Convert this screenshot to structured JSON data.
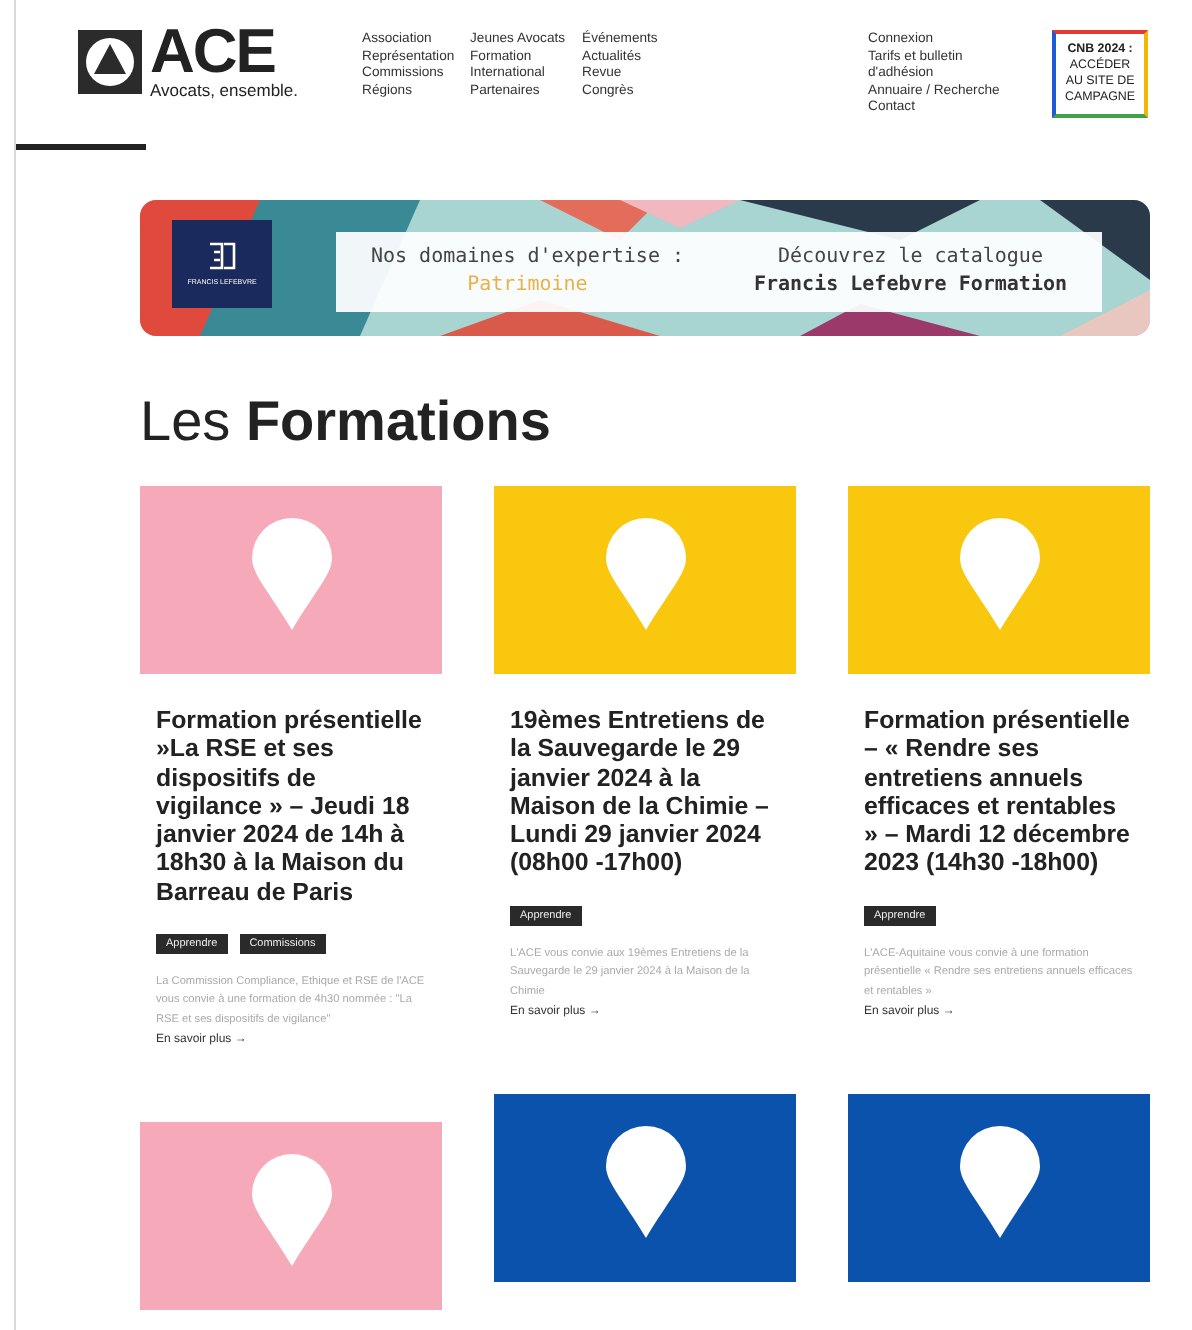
{
  "header": {
    "logo": {
      "name": "ACE",
      "tagline": "Avocats, ensemble."
    },
    "nav_columns": [
      [
        "Association",
        "Représentation",
        "Commissions",
        "Régions"
      ],
      [
        "Jeunes Avocats",
        "Formation",
        "International",
        "Partenaires"
      ],
      [
        "Événements",
        "Actualités",
        "Revue",
        "Congrès"
      ]
    ],
    "account_links": [
      "Connexion",
      "Tarifs et bulletin d'adhésion",
      "Annuaire / Recherche",
      "Contact"
    ],
    "campaign_button": {
      "title": "CNB 2024 :",
      "text": "ACCÉDER AU SITE DE CAMPAGNE"
    }
  },
  "banner": {
    "logo_text": "FRANCIS LEFEBVRE",
    "left_line": "Nos domaines d'expertise :",
    "left_highlight": "Patrimoine",
    "right_line": "Découvrez le catalogue",
    "right_bold": "Francis Lefebvre Formation"
  },
  "section_title": "Les **Formations**",
  "columns": [
    {
      "cards": [
        {
          "color": "#f6a9b8",
          "title": "Formation présentielle »La RSE et ses dispositifs de vigilance » – Jeudi 18 janvier 2024 de 14h à 18h30 à la Maison du Barreau de Paris",
          "tags": [
            "Apprendre",
            "Commissions"
          ],
          "excerpt": "La Commission Compliance, Ethique et RSE de l'ACE vous convie à une formation de 4h30 nommée : \"La RSE et ses dispositifs de vigilance\"",
          "link": "En savoir plus →"
        },
        {
          "color": "#f6a9b8"
        }
      ]
    },
    {
      "cards": [
        {
          "color": "#f9c80e",
          "title": "19èmes Entretiens de la Sauvegarde le 29 janvier 2024 à la Maison de la Chimie – Lundi 29 janvier 2024 (08h00 -17h00)",
          "tags": [
            "Apprendre"
          ],
          "excerpt": "L'ACE vous convie aux 19èmes Entretiens de la Sauvegarde le 29 janvier 2024 à la Maison de la Chimie",
          "link": "En savoir plus →"
        },
        {
          "color": "#0b52ad"
        }
      ]
    },
    {
      "cards": [
        {
          "color": "#f9c80e",
          "title": "Formation présentielle – « Rendre ses entretiens annuels efficaces et rentables » – Mardi 12 décembre 2023 (14h30 -18h00)",
          "tags": [
            "Apprendre"
          ],
          "excerpt": "L'ACE-Aquitaine vous convie à une formation présentielle « Rendre ses entretiens annuels efficaces et rentables »",
          "link": "En savoir plus →"
        },
        {
          "color": "#0b52ad"
        }
      ]
    }
  ]
}
